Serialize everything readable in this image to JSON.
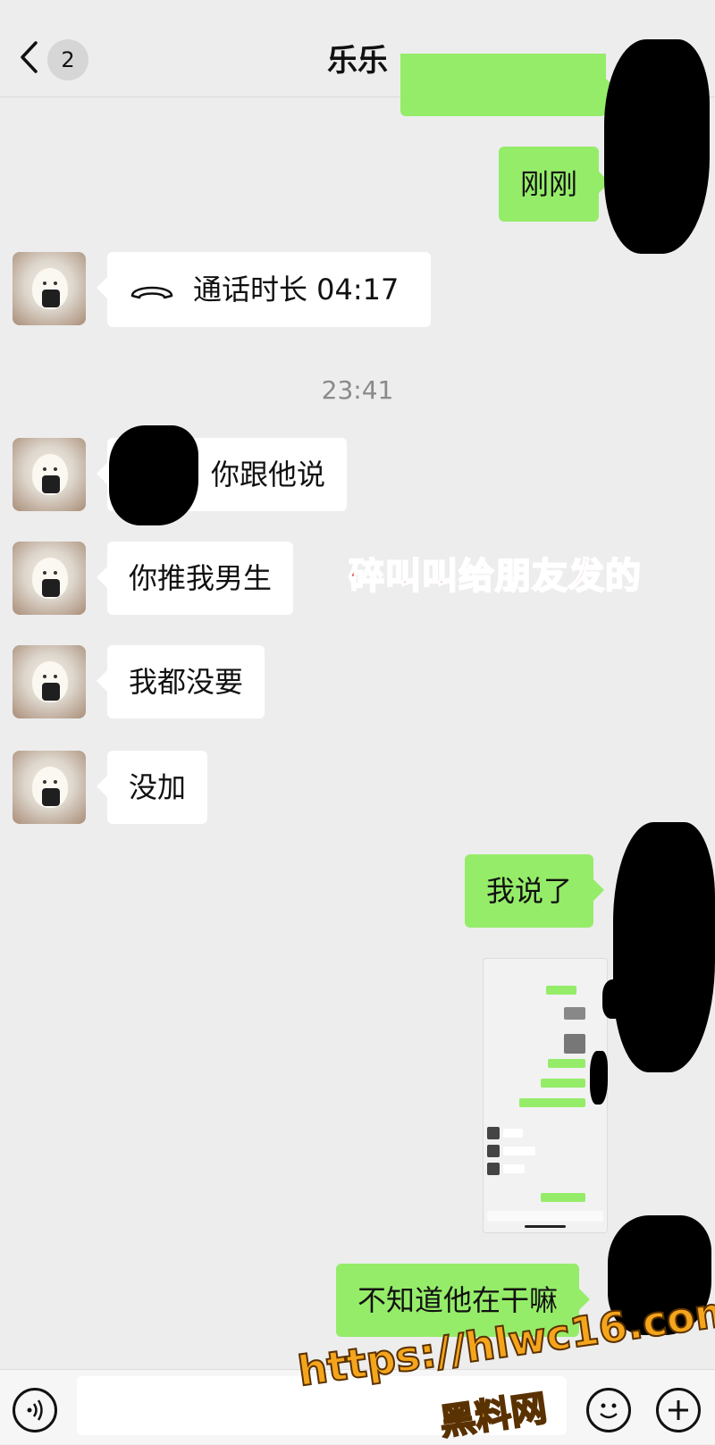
{
  "header": {
    "back_count": "2",
    "title": "乐乐"
  },
  "messages": {
    "out1": "刚刚",
    "call_duration": "通话时长 04:17",
    "timestamp": "23:41",
    "in1": "你跟他说",
    "in2": "你推我男生",
    "in3": "我都没要",
    "in4": "没加",
    "out2": "我说了",
    "out3": "不知道他在干嘛"
  },
  "overlay_caption": "碎叫叫给朋友发的",
  "watermark": {
    "url": "https://hlwc16.com",
    "site": "黑料网"
  },
  "colors": {
    "outgoing_bubble": "#95ec69",
    "incoming_bubble": "#ffffff",
    "background": "#ededed",
    "caption_red": "#e2262e"
  },
  "icons": {
    "back": "chevron-left",
    "call": "phone-hangup",
    "voice": "voice-wave",
    "emoji": "smiley",
    "more": "plus"
  }
}
